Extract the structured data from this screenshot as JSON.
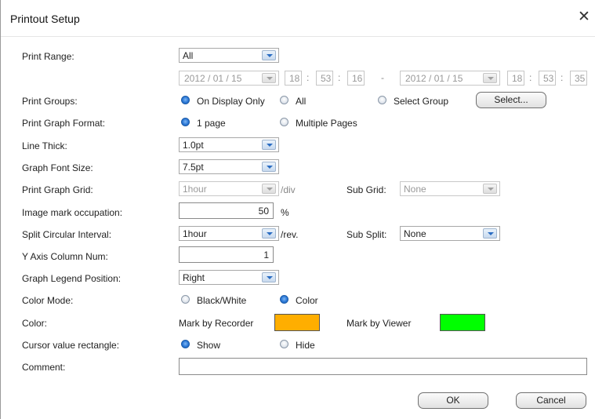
{
  "dialog": {
    "title": "Printout Setup",
    "close_glyph": "✕"
  },
  "labels": {
    "print_range": "Print Range:",
    "print_groups": "Print Groups:",
    "print_graph_format": "Print Graph Format:",
    "line_thick": "Line Thick:",
    "graph_font_size": "Graph Font Size:",
    "print_graph_grid": "Print Graph Grid:",
    "image_mark_occupation": "Image mark occupation:",
    "split_circular_interval": "Split Circular Interval:",
    "y_axis_column_num": "Y Axis Column Num:",
    "graph_legend_position": "Graph Legend Position:",
    "color_mode": "Color Mode:",
    "color": "Color:",
    "cursor_value_rectangle": "Cursor value rectangle:",
    "comment": "Comment:"
  },
  "print_range": {
    "value": "All",
    "start_date": "2012  /  01  /  15",
    "start_time": {
      "h": "18",
      "m": "53",
      "s": "16"
    },
    "dash": "-",
    "end_date": "2012  /  01  /  15",
    "end_time": {
      "h": "18",
      "m": "53",
      "s": "35"
    },
    "colon": ":"
  },
  "print_groups": {
    "options": [
      "On Display Only",
      "All",
      "Select Group"
    ],
    "selected": "On Display Only",
    "select_button": "Select..."
  },
  "print_graph_format": {
    "options": [
      "1 page",
      "Multiple Pages"
    ],
    "selected": "1 page"
  },
  "line_thick": {
    "value": "1.0pt"
  },
  "graph_font_size": {
    "value": "7.5pt"
  },
  "print_graph_grid": {
    "value": "1hour",
    "unit": "/div",
    "sub_grid_label": "Sub Grid:",
    "sub_grid_value": "None"
  },
  "image_mark_occupation": {
    "value": "50",
    "unit": "%"
  },
  "split_circular_interval": {
    "value": "1hour",
    "unit": "/rev.",
    "sub_split_label": "Sub Split:",
    "sub_split_value": "None"
  },
  "y_axis_column_num": {
    "value": "1"
  },
  "graph_legend_position": {
    "value": "Right"
  },
  "color_mode": {
    "options": [
      "Black/White",
      "Color"
    ],
    "selected": "Color"
  },
  "color": {
    "recorder_label": "Mark by Recorder",
    "recorder_color": "#FFAE00",
    "viewer_label": "Mark by Viewer",
    "viewer_color": "#00FF00"
  },
  "cursor_value_rectangle": {
    "options": [
      "Show",
      "Hide"
    ],
    "selected": "Show"
  },
  "comment": {
    "value": ""
  },
  "buttons": {
    "ok": "OK",
    "cancel": "Cancel"
  }
}
